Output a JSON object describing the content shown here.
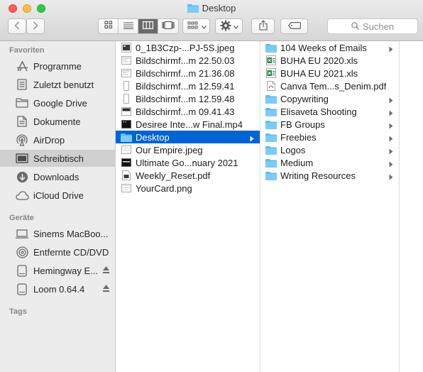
{
  "window": {
    "title": "Desktop"
  },
  "toolbar": {
    "search_placeholder": "Suchen"
  },
  "sidebar": {
    "sections": [
      {
        "label": "Favoriten",
        "items": [
          {
            "label": "Programme",
            "icon": "applications-icon"
          },
          {
            "label": "Zuletzt benutzt",
            "icon": "recents-icon"
          },
          {
            "label": "Google Drive",
            "icon": "folder-icon"
          },
          {
            "label": "Dokumente",
            "icon": "documents-icon"
          },
          {
            "label": "AirDrop",
            "icon": "airdrop-icon"
          },
          {
            "label": "Schreibtisch",
            "icon": "desktop-icon",
            "selected": true
          },
          {
            "label": "Downloads",
            "icon": "downloads-icon"
          },
          {
            "label": "iCloud Drive",
            "icon": "cloud-icon"
          }
        ]
      },
      {
        "label": "Geräte",
        "items": [
          {
            "label": "Sinems MacBoo...",
            "icon": "laptop-icon"
          },
          {
            "label": "Entfernte CD/DVD",
            "icon": "disc-icon"
          },
          {
            "label": "Hemingway E...",
            "icon": "drive-icon",
            "eject": true
          },
          {
            "label": "Loom 0.64.4",
            "icon": "drive-icon",
            "eject": true
          }
        ]
      },
      {
        "label": "Tags",
        "items": []
      }
    ]
  },
  "columns": {
    "column1": [
      {
        "name": "0_1B3Czp-...PJ-5S.jpeg",
        "icon": "image-file-icon"
      },
      {
        "name": "Bildschirmf...m 22.50.03",
        "icon": "screenshot-icon"
      },
      {
        "name": "Bildschirmf...m 21.36.08",
        "icon": "screenshot-icon"
      },
      {
        "name": "Bildschirmf...m 12.59.41",
        "icon": "screenshot-narrow-icon"
      },
      {
        "name": "Bildschirmf...m 12.59.48",
        "icon": "screenshot-narrow-icon"
      },
      {
        "name": "Bildschirmf...m 09.41.43",
        "icon": "screenshot-dark-icon"
      },
      {
        "name": "Desiree Inte...w Final.mp4",
        "icon": "video-file-icon"
      },
      {
        "name": "Desktop",
        "icon": "folder-icon",
        "selected": true,
        "has_children": true
      },
      {
        "name": "Our Empire.jpeg",
        "icon": "image-file-icon"
      },
      {
        "name": "Ultimate Go...nuary 2021",
        "icon": "video-file-icon"
      },
      {
        "name": "Weekly_Reset.pdf",
        "icon": "pdf-file-icon"
      },
      {
        "name": "YourCard.png",
        "icon": "image-file-icon"
      }
    ],
    "column2": [
      {
        "name": "104 Weeks of Emails",
        "icon": "folder-icon",
        "has_children": true
      },
      {
        "name": "BUHA EU 2020.xls",
        "icon": "excel-file-icon"
      },
      {
        "name": "BUHA EU 2021.xls",
        "icon": "excel-file-icon"
      },
      {
        "name": "Canva Tem...s_Denim.pdf",
        "icon": "pdf-file-icon"
      },
      {
        "name": "Copywriting",
        "icon": "folder-icon",
        "has_children": true
      },
      {
        "name": "Elisaveta Shooting",
        "icon": "folder-icon",
        "has_children": true
      },
      {
        "name": "FB Groups",
        "icon": "folder-icon",
        "has_children": true
      },
      {
        "name": "Freebies",
        "icon": "folder-icon",
        "has_children": true
      },
      {
        "name": "Logos",
        "icon": "folder-icon",
        "has_children": true
      },
      {
        "name": "Medium",
        "icon": "folder-icon",
        "has_children": true
      },
      {
        "name": "Writing Resources",
        "icon": "folder-icon",
        "has_children": true
      }
    ]
  },
  "colors": {
    "selection": "#0064d2",
    "folder": "#5bbcf3",
    "sidebar_bg": "#ececec",
    "excel": "#1e7a45"
  }
}
